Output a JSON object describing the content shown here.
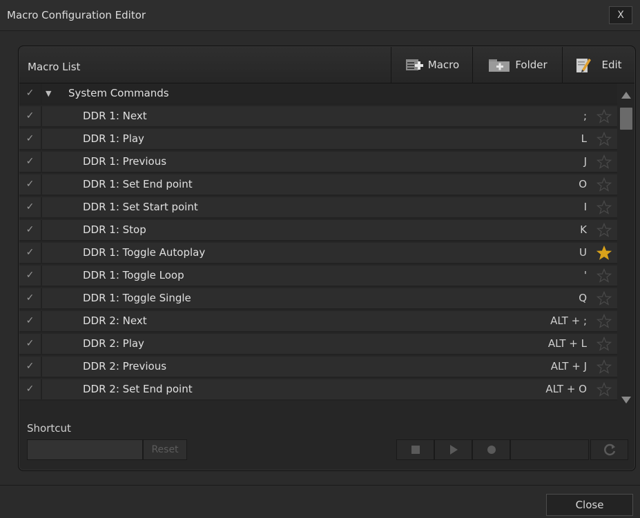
{
  "window": {
    "title": "Macro Configuration Editor",
    "close_label": "X"
  },
  "header": {
    "list_title": "Macro List",
    "macro_label": "Macro",
    "folder_label": "Folder",
    "edit_label": "Edit"
  },
  "group": {
    "name": "System Commands"
  },
  "check_glyph": "✓",
  "macros": [
    {
      "name": "DDR 1: Next",
      "key": ";",
      "favorite": false
    },
    {
      "name": "DDR 1: Play",
      "key": "L",
      "favorite": false
    },
    {
      "name": "DDR 1: Previous",
      "key": "J",
      "favorite": false
    },
    {
      "name": "DDR 1: Set End point",
      "key": "O",
      "favorite": false
    },
    {
      "name": "DDR 1: Set Start point",
      "key": "I",
      "favorite": false
    },
    {
      "name": "DDR 1: Stop",
      "key": "K",
      "favorite": false
    },
    {
      "name": "DDR 1: Toggle Autoplay",
      "key": "U",
      "favorite": true
    },
    {
      "name": "DDR 1: Toggle Loop",
      "key": "'",
      "favorite": false
    },
    {
      "name": "DDR 1: Toggle Single",
      "key": "Q",
      "favorite": false
    },
    {
      "name": "DDR 2: Next",
      "key": "ALT + ;",
      "favorite": false
    },
    {
      "name": "DDR 2: Play",
      "key": "ALT + L",
      "favorite": false
    },
    {
      "name": "DDR 2: Previous",
      "key": "ALT + J",
      "favorite": false
    },
    {
      "name": "DDR 2: Set End point",
      "key": "ALT + O",
      "favorite": false
    }
  ],
  "shortcut": {
    "label": "Shortcut",
    "value": "",
    "reset_label": "Reset"
  },
  "footer": {
    "close_label": "Close"
  },
  "colors": {
    "star_active": "#d9a21b",
    "star_inactive": "#4a4a4a"
  }
}
